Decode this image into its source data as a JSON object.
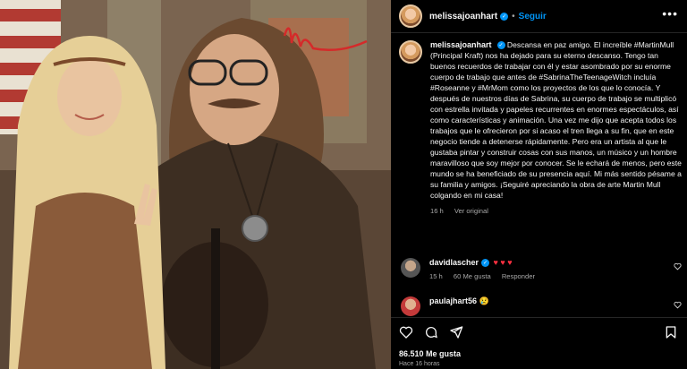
{
  "post": {
    "username": "melissajoanhart",
    "verified_badge": "✓",
    "dot": "•",
    "follow_label": "Seguir",
    "more_label": "•••"
  },
  "caption": {
    "username": "melissajoanhart",
    "text": "Descansa en paz amigo. El increíble #MartinMull (Principal Kraft) nos ha dejado para su eterno descanso. Tengo tan buenos recuerdos de trabajar con él y estar asombrado por su enorme cuerpo de trabajo que antes de #SabrinaTheTeenageWitch incluía #Roseanne y #MrMom como los proyectos de los que lo conocía. Y después de nuestros días de Sabrina, su cuerpo de trabajo se multiplicó con estrella invitada y papeles recurrentes en enormes espectáculos, así como características y animación. Una vez me dijo que acepta todos los trabajos que le ofrecieron por si acaso el tren llega a su fin, que en este negocio tiende a detenerse rápidamente. Pero era un artista al que le gustaba pintar y construir cosas con sus manos, un músico y un hombre maravilloso que soy mejor por conocer. Se le echará de menos, pero este mundo se ha beneficiado de su presencia aquí. Mi más sentido pésame a su familia y amigos. ¡Seguiré apreciando la obra de arte Martin Mull colgando en mi casa!",
    "age": "16 h",
    "see_translation": "Ver original"
  },
  "comments": [
    {
      "username": "davidlascher",
      "verified_badge": "✓",
      "text": "♥ ♥ ♥",
      "age": "15 h",
      "likes": "60 Me gusta",
      "reply": "Responder",
      "like_icon": "heart-outline-icon"
    },
    {
      "username": "paulajhart56",
      "text": "😢",
      "like_icon": "heart-outline-icon"
    }
  ],
  "stats": {
    "likes": "86.510 Me gusta",
    "time": "Hace 16 horas"
  },
  "icons": [
    "heart-icon",
    "comment-icon",
    "share-icon",
    "bookmark-icon"
  ],
  "colors": {
    "accent": "#0095f6",
    "heart": "#ff3040",
    "muted": "#a8a8a8"
  }
}
